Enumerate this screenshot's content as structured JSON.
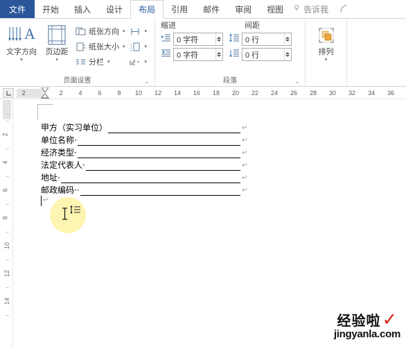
{
  "window": {
    "app": "Word"
  },
  "tabs": [
    {
      "id": "file",
      "label": "文件",
      "state": "file"
    },
    {
      "id": "start",
      "label": "开始",
      "state": "normal"
    },
    {
      "id": "insert",
      "label": "插入",
      "state": "normal"
    },
    {
      "id": "design",
      "label": "设计",
      "state": "normal"
    },
    {
      "id": "layout",
      "label": "布局",
      "state": "active"
    },
    {
      "id": "refs",
      "label": "引用",
      "state": "normal"
    },
    {
      "id": "mail",
      "label": "邮件",
      "state": "normal"
    },
    {
      "id": "review",
      "label": "审阅",
      "state": "normal"
    },
    {
      "id": "view",
      "label": "视图",
      "state": "normal"
    },
    {
      "id": "tellme",
      "label": "告诉我",
      "state": "tellme"
    }
  ],
  "ribbon": {
    "groups": {
      "page_setup": {
        "title": "页面设置",
        "big_buttons": [
          {
            "id": "text-direction",
            "label": "文字方向",
            "icon": "text-direction-icon"
          },
          {
            "id": "margins",
            "label": "页边距",
            "icon": "margins-icon"
          }
        ],
        "small_buttons": [
          {
            "id": "orientation",
            "label": "纸张方向",
            "icon": "paper-orientation-icon"
          },
          {
            "id": "size",
            "label": "纸张大小",
            "icon": "paper-size-icon"
          },
          {
            "id": "columns",
            "label": "分栏",
            "icon": "columns-icon"
          }
        ],
        "icon_buttons": [
          {
            "id": "breaks",
            "icon": "breaks-icon"
          },
          {
            "id": "line-numbers",
            "icon": "line-numbers-icon"
          },
          {
            "id": "hyphenation",
            "icon": "hyphenation-icon"
          }
        ]
      },
      "paragraph": {
        "title": "段落",
        "indent_header": "缩进",
        "spacing_header": "间距",
        "fields": [
          {
            "id": "indent-left",
            "icon": "indent-left-icon",
            "value": "0 字符"
          },
          {
            "id": "indent-right",
            "icon": "indent-right-icon",
            "value": "0 字符"
          },
          {
            "id": "spacing-before",
            "icon": "spacing-before-icon",
            "value": "0 行"
          },
          {
            "id": "spacing-after",
            "icon": "spacing-after-icon",
            "value": "0 行"
          }
        ]
      },
      "arrange": {
        "title": "排列",
        "button": {
          "id": "arrange",
          "label": "排列",
          "icon": "arrange-icon"
        }
      }
    }
  },
  "rulers": {
    "horizontal": {
      "left_marker_label": "2",
      "ticks": [
        "2",
        "4",
        "6",
        "8",
        "10",
        "12",
        "14",
        "16",
        "18",
        "20",
        "22",
        "24",
        "26",
        "28",
        "30",
        "32",
        "34",
        "36"
      ]
    },
    "vertical": {
      "ticks": [
        "2",
        "4",
        "6",
        "8",
        "10",
        "12",
        "14"
      ]
    }
  },
  "document": {
    "lines": [
      {
        "label": "甲方（实习单位）",
        "rule": true,
        "mark": "↵"
      },
      {
        "label": "单位名称·",
        "rule": true,
        "mark": "↵"
      },
      {
        "label": "经济类型·",
        "rule": true,
        "mark": "↵"
      },
      {
        "label": "法定代表人·",
        "rule": true,
        "mark": "↵"
      },
      {
        "label": "地址·",
        "rule": true,
        "mark": "↵"
      },
      {
        "label": "邮政编码··",
        "rule": true,
        "mark": "↵"
      }
    ],
    "empty_line_mark": "↵"
  },
  "watermark": {
    "cn": "经验啦",
    "check": "✓",
    "en": "jingyanla.com"
  },
  "colors": {
    "file_tab": "#2b579a",
    "active_tab_text": "#2b579a",
    "accent_orange": "#e8a33d",
    "watermark_red": "#d8241f",
    "highlight_yellow": "#fdf3a0"
  }
}
